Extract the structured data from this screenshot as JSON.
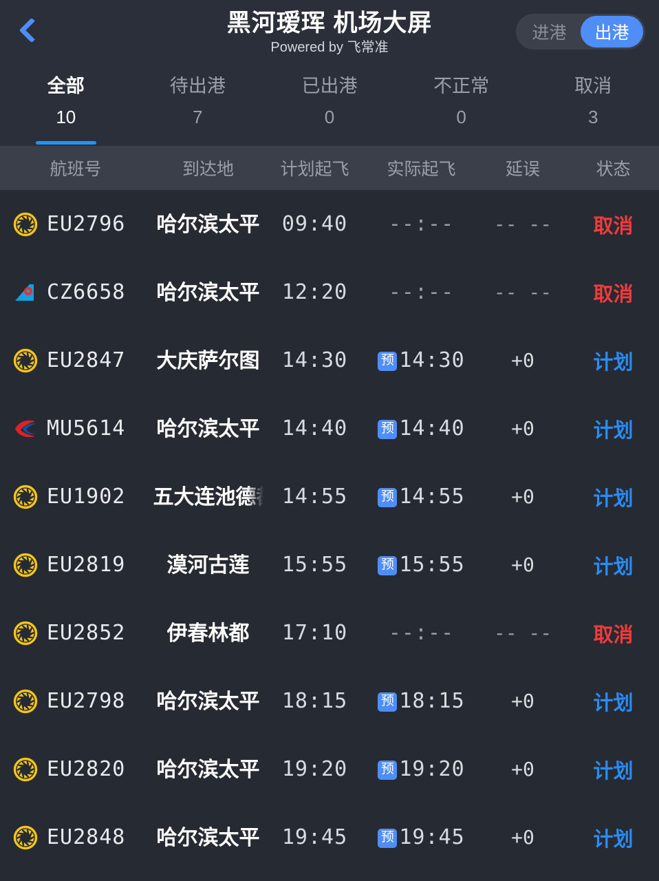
{
  "header": {
    "back_icon": "chevron-left-icon",
    "title": "黑河瑷珲 机场大屏",
    "subtitle": "Powered by 飞常准",
    "toggle": {
      "arrival_label": "进港",
      "departure_label": "出港",
      "selected": "出港",
      "active_color": "#4f8ef7"
    }
  },
  "tabs": [
    {
      "label": "全部",
      "count": "10",
      "active": true
    },
    {
      "label": "待出港",
      "count": "7",
      "active": false
    },
    {
      "label": "已出港",
      "count": "0",
      "active": false
    },
    {
      "label": "不正常",
      "count": "0",
      "active": false
    },
    {
      "label": "取消",
      "count": "3",
      "active": false
    }
  ],
  "columns": {
    "flight": "航班号",
    "destination": "到达地",
    "scheduled": "计划起飞",
    "actual": "实际起飞",
    "delay": "延误",
    "status": "状态"
  },
  "badge_label": "预",
  "colors": {
    "background": "#262a33",
    "header_bg": "#2b2f39",
    "column_header_bg": "#3a3f4a",
    "accent": "#2196f3",
    "cancel": "#f23b3b",
    "planned": "#2b8cf5"
  },
  "flights": [
    {
      "airline_logo": "chengdu-airlines-logo",
      "flight_no": "EU2796",
      "destination": "哈尔滨太平",
      "truncated": false,
      "scheduled": "09:40",
      "actual": "--:--",
      "has_badge": false,
      "delay": "-- --",
      "status": "取消",
      "status_type": "cancel"
    },
    {
      "airline_logo": "china-southern-logo",
      "flight_no": "CZ6658",
      "destination": "哈尔滨太平",
      "truncated": false,
      "scheduled": "12:20",
      "actual": "--:--",
      "has_badge": false,
      "delay": "-- --",
      "status": "取消",
      "status_type": "cancel"
    },
    {
      "airline_logo": "chengdu-airlines-logo",
      "flight_no": "EU2847",
      "destination": "大庆萨尔图",
      "truncated": false,
      "scheduled": "14:30",
      "actual": "14:30",
      "has_badge": true,
      "delay": "+0",
      "status": "计划",
      "status_type": "planned"
    },
    {
      "airline_logo": "china-eastern-logo",
      "flight_no": "MU5614",
      "destination": "哈尔滨太平",
      "truncated": false,
      "scheduled": "14:40",
      "actual": "14:40",
      "has_badge": true,
      "delay": "+0",
      "status": "计划",
      "status_type": "planned"
    },
    {
      "airline_logo": "chengdu-airlines-logo",
      "flight_no": "EU1902",
      "destination": "五大连池德都",
      "truncated": true,
      "scheduled": "14:55",
      "actual": "14:55",
      "has_badge": true,
      "delay": "+0",
      "status": "计划",
      "status_type": "planned"
    },
    {
      "airline_logo": "chengdu-airlines-logo",
      "flight_no": "EU2819",
      "destination": "漠河古莲",
      "truncated": false,
      "scheduled": "15:55",
      "actual": "15:55",
      "has_badge": true,
      "delay": "+0",
      "status": "计划",
      "status_type": "planned"
    },
    {
      "airline_logo": "chengdu-airlines-logo",
      "flight_no": "EU2852",
      "destination": "伊春林都",
      "truncated": false,
      "scheduled": "17:10",
      "actual": "--:--",
      "has_badge": false,
      "delay": "-- --",
      "status": "取消",
      "status_type": "cancel"
    },
    {
      "airline_logo": "chengdu-airlines-logo",
      "flight_no": "EU2798",
      "destination": "哈尔滨太平",
      "truncated": false,
      "scheduled": "18:15",
      "actual": "18:15",
      "has_badge": true,
      "delay": "+0",
      "status": "计划",
      "status_type": "planned"
    },
    {
      "airline_logo": "chengdu-airlines-logo",
      "flight_no": "EU2820",
      "destination": "哈尔滨太平",
      "truncated": false,
      "scheduled": "19:20",
      "actual": "19:20",
      "has_badge": true,
      "delay": "+0",
      "status": "计划",
      "status_type": "planned"
    },
    {
      "airline_logo": "chengdu-airlines-logo",
      "flight_no": "EU2848",
      "destination": "哈尔滨太平",
      "truncated": false,
      "scheduled": "19:45",
      "actual": "19:45",
      "has_badge": true,
      "delay": "+0",
      "status": "计划",
      "status_type": "planned"
    }
  ]
}
